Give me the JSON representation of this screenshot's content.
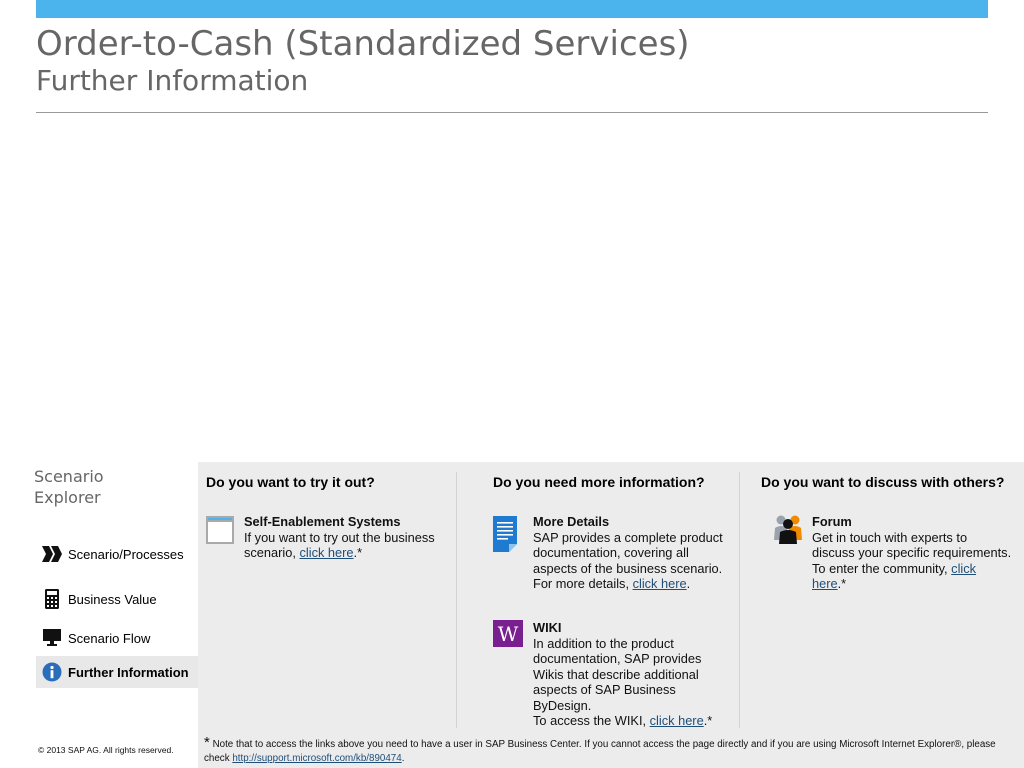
{
  "slide": {
    "title": "Order-to-Cash (Standardized Services)",
    "subtitle": "Further Information",
    "accent_color": "#4cb4ec"
  },
  "sidebar": {
    "heading_line1": "Scenario",
    "heading_line2": "Explorer",
    "items": [
      {
        "label": "Scenario/Processes",
        "icon": "chevron-arrows-icon",
        "active": false
      },
      {
        "label": "Business Value",
        "icon": "calculator-icon",
        "active": false
      },
      {
        "label": "Scenario Flow",
        "icon": "monitor-icon",
        "active": false
      },
      {
        "label": "Further Information",
        "icon": "info-icon",
        "active": true
      }
    ]
  },
  "columns": [
    {
      "heading": "Do you want to try it out?",
      "items": [
        {
          "title": "Self-Enablement Systems",
          "text_before": "If you want to try out the  business scenario,  ",
          "link_text": "click here",
          "text_after": ".*",
          "icon": "browser-window-icon"
        }
      ]
    },
    {
      "heading": "Do you need more information?",
      "items": [
        {
          "title": "More Details",
          "text_before": "SAP provides a complete product documentation, covering all aspects of the business scenario. For more details, ",
          "link_text": "click here",
          "text_after": ".",
          "icon": "document-icon"
        },
        {
          "title": "WIKI",
          "text_before": "In addition to the product documentation, SAP provides Wikis that describe additional aspects of SAP Business ByDesign.",
          "text_line2": "To access the WIKI, ",
          "link_text": "click here",
          "text_after": ".*",
          "icon": "wiki-icon",
          "icon_letter": "W"
        }
      ]
    },
    {
      "heading": "Do you want to discuss with others?",
      "items": [
        {
          "title": "Forum",
          "text_before": "Get in touch with experts to discuss your specific requirements. To enter the community, ",
          "link_text": "click here",
          "text_after": ".*",
          "icon": "people-icon"
        }
      ]
    }
  ],
  "footer": {
    "copyright": "©  2013 SAP AG. All rights reserved.",
    "footnote_star": "*",
    "footnote_text": " Note that to access the links above you need to have a user in SAP Business Center. If you cannot access the page directly and if you are using Microsoft Internet Explorer®, please check ",
    "footnote_link": "http://support.microsoft.com/kb/890474",
    "footnote_end": "."
  }
}
